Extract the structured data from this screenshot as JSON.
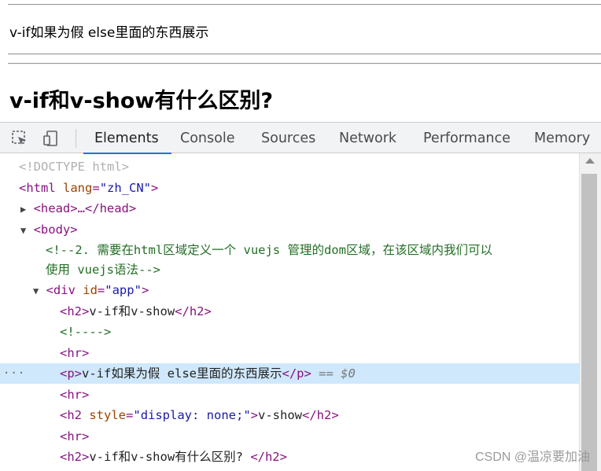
{
  "page": {
    "paragraph": "v-if如果为假 else里面的东西展示",
    "heading": "v-if和v-show有什么区别?"
  },
  "devtools": {
    "tabs": [
      "Elements",
      "Console",
      "Sources",
      "Network",
      "Performance",
      "Memory"
    ],
    "active_tab": "Elements",
    "tree": {
      "doctype": "<!DOCTYPE html>",
      "html_open": "<html",
      "html_attr": "lang",
      "html_val": "\"zh_CN\"",
      "head_line": "<head>…</head>",
      "body_open": "<body>",
      "comment_1": "<!--2. 需要在html区域定义一个 vuejs 管理的dom区域，在该区域内我们可以",
      "comment_2": "使用 vuejs语法-->",
      "div_open": "<div",
      "div_attr": "id",
      "div_val": "\"app\"",
      "h2_open": "<h2>",
      "h2_text": "v-if和v-show",
      "h2_close": "</h2>",
      "empty_comment": "<!---->",
      "hr": "<hr>",
      "p_open": "<p>",
      "p_text": "v-if如果为假 else里面的东西展示",
      "p_close": "</p>",
      "p_marker": "== $0",
      "h2s_open": "<h2",
      "h2s_attr": "style",
      "h2s_val": "\"display: none;\"",
      "h2s_text": "v-show",
      "h2q_text": "v-if和v-show有什么区别? ",
      "selected_dots": "···"
    }
  },
  "watermark": "CSDN @温凉要加油"
}
